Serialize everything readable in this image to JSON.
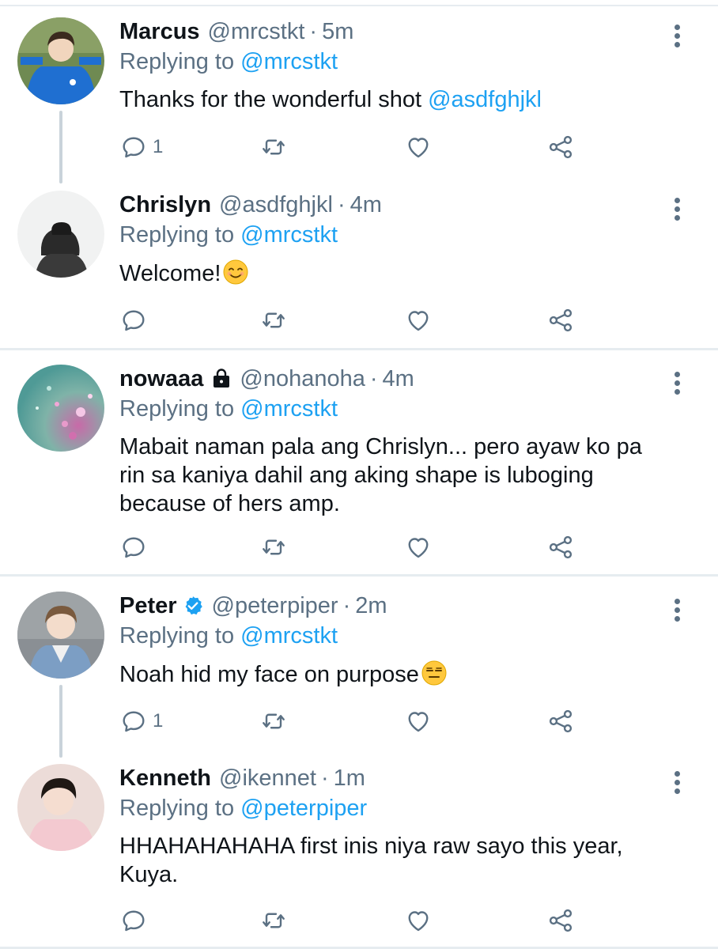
{
  "tweets": [
    {
      "name": "Marcus",
      "handle": "@mrcstkt",
      "dot": "·",
      "time": "5m",
      "replying_prefix": "Replying to",
      "replying_to": "@mrcstkt",
      "text_plain": "Thanks for the wonderful shot",
      "text_mention": "@asdfghjkl",
      "reply_count": "1",
      "avatar_desc": "person-blue-shirt-avatar"
    },
    {
      "name": "Chrislyn",
      "handle": "@asdfghjkl",
      "dot": "·",
      "time": "4m",
      "replying_prefix": "Replying to",
      "replying_to": "@mrcstkt",
      "text_plain": "Welcome!",
      "emoji": "smiling-face-emoji",
      "reply_count": "",
      "avatar_desc": "silhouette-avatar"
    },
    {
      "name": "nowaaa",
      "handle": "@nohanoha",
      "dot": "·",
      "time": "4m",
      "replying_prefix": "Replying to",
      "replying_to": "@mrcstkt",
      "text_plain": "Mabait naman pala ang Chrislyn... pero ayaw ko pa rin sa kaniya dahil ang aking shape is luboging because of hers amp.",
      "protected_icon": "lock-icon",
      "reply_count": "",
      "avatar_desc": "glitter-avatar"
    },
    {
      "name": "Peter",
      "handle": "@peterpiper",
      "dot": "·",
      "time": "2m",
      "replying_prefix": "Replying to",
      "replying_to": "@mrcstkt",
      "text_plain": "Noah hid my face on purpose",
      "emoji": "expressionless-face-emoji",
      "verified_icon": "verified-badge-icon",
      "reply_count": "1",
      "avatar_desc": "person-denim-jacket-avatar"
    },
    {
      "name": "Kenneth",
      "handle": "@ikennet",
      "dot": "·",
      "time": "1m",
      "replying_prefix": "Replying to",
      "replying_to": "@peterpiper",
      "text_plain": "HHAHAHAHAHA first inis niya raw sayo this year, Kuya.",
      "reply_count": "",
      "avatar_desc": "person-pink-shirt-avatar"
    }
  ],
  "icons": {
    "reply": "reply-icon",
    "retweet": "retweet-icon",
    "like": "heart-icon",
    "share": "share-icon",
    "more": "more-vertical-icon"
  },
  "colors": {
    "accent": "#1da1f2",
    "secondary_text": "#5b7083",
    "divider": "#e6ecf0",
    "verified": "#1da1f2"
  }
}
